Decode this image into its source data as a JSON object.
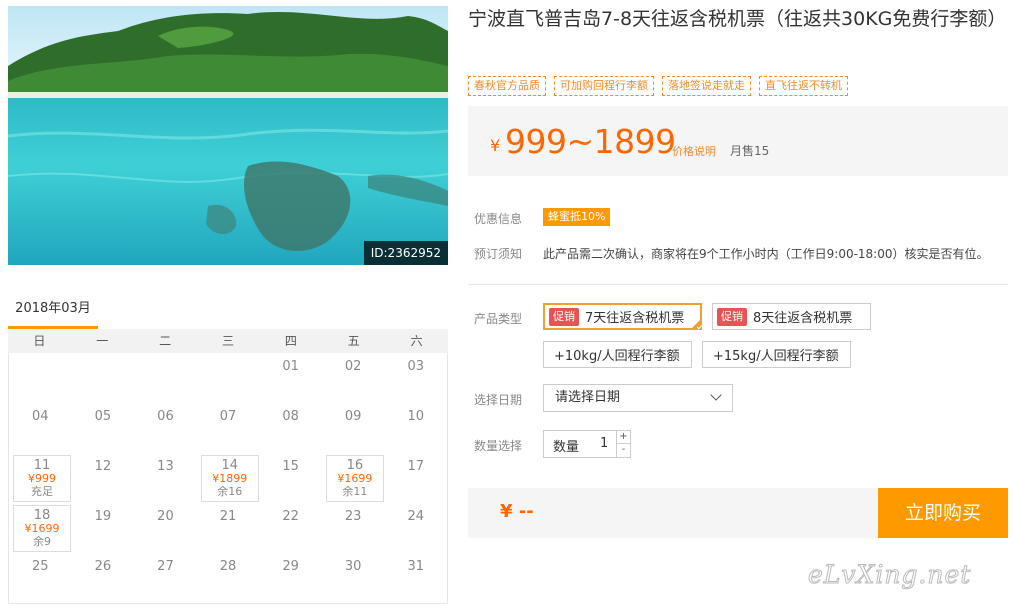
{
  "hero": {
    "id_label": "ID:2362952"
  },
  "product": {
    "title": "宁波直飞普吉岛7-8天往返含税机票（往返共30KG免费行李额）",
    "tags": [
      "春秋官方品质",
      "可加购回程行李额",
      "落地签说走就走",
      "直飞往返不转机"
    ],
    "price_currency": "¥",
    "price_range": "999~1899",
    "price_note": "价格说明",
    "monthly_sold": "月售15"
  },
  "info": {
    "discount_label": "优惠信息",
    "discount_badge": "蜂蜜抵10%",
    "notice_label": "预订须知",
    "notice_text": "此产品需二次确认，商家将在9个工作小时内（工作日9:00-18:00）核实是否有位。"
  },
  "options": {
    "type_label": "产品类型",
    "promo_badge": "促销",
    "types": [
      "7天往返含税机票",
      "8天往返含税机票"
    ],
    "addons": [
      "+10kg/人回程行李额",
      "+15kg/人回程行李额"
    ],
    "date_label": "选择日期",
    "date_placeholder": "请选择日期",
    "qty_label": "数量选择",
    "qty_field_label": "数量",
    "qty_value": "1",
    "qty_plus": "+",
    "qty_minus": "-"
  },
  "buy": {
    "total_currency": "¥",
    "total_value": "--",
    "button": "立即购买"
  },
  "calendar": {
    "month": "2018年03月",
    "weekdays": [
      "日",
      "一",
      "二",
      "三",
      "四",
      "五",
      "六"
    ],
    "rows": [
      [
        {
          "day": ""
        },
        {
          "day": ""
        },
        {
          "day": ""
        },
        {
          "day": ""
        },
        {
          "day": "01"
        },
        {
          "day": "02"
        },
        {
          "day": "03"
        }
      ],
      [
        {
          "day": "04"
        },
        {
          "day": "05"
        },
        {
          "day": "06"
        },
        {
          "day": "07"
        },
        {
          "day": "08"
        },
        {
          "day": "09"
        },
        {
          "day": "10"
        }
      ],
      [
        {
          "day": "11",
          "price": "¥999",
          "stock": "充足"
        },
        {
          "day": "12"
        },
        {
          "day": "13"
        },
        {
          "day": "14",
          "price": "¥1899",
          "stock": "余16"
        },
        {
          "day": "15"
        },
        {
          "day": "16",
          "price": "¥1699",
          "stock": "余11"
        },
        {
          "day": "17"
        }
      ],
      [
        {
          "day": "18",
          "price": "¥1699",
          "stock": "余9"
        },
        {
          "day": "19"
        },
        {
          "day": "20"
        },
        {
          "day": "21"
        },
        {
          "day": "22"
        },
        {
          "day": "23"
        },
        {
          "day": "24"
        }
      ],
      [
        {
          "day": "25"
        },
        {
          "day": "26"
        },
        {
          "day": "27"
        },
        {
          "day": "28"
        },
        {
          "day": "29"
        },
        {
          "day": "30"
        },
        {
          "day": "31"
        }
      ]
    ]
  },
  "watermark": "eLvXing.net",
  "colors": {
    "accent": "#ff9900",
    "price": "#ff6600",
    "promo": "#e85454"
  }
}
